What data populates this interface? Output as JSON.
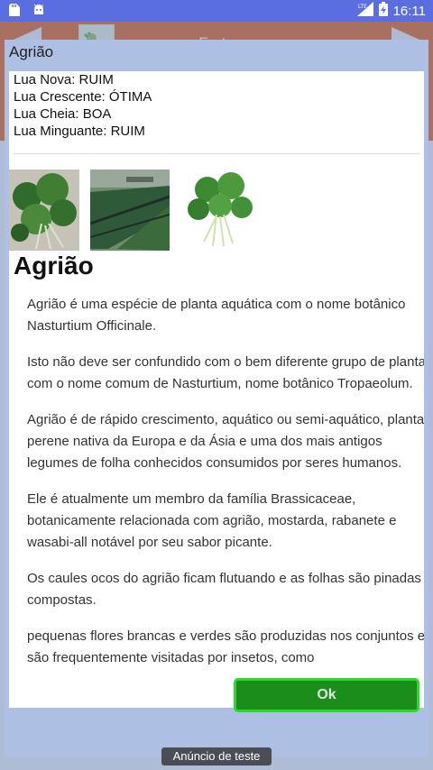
{
  "status_bar": {
    "time": "16:11",
    "network": "LTE",
    "battery_level": "charging"
  },
  "background_app": {
    "title": "Fruto"
  },
  "dialog": {
    "title": "Agrião",
    "moon_phases": [
      "Lua Nova: RUIM",
      "Lua Crescente: ÓTIMA",
      "Lua Cheia: BOA",
      "Lua Minguante: RUIM"
    ],
    "heading": "Agrião",
    "paragraphs": [
      "Agrião é uma espécie de planta aquática com o nome botânico Nasturtium Officinale.",
      "Isto não deve ser confundido com o bem diferente grupo de plantas com o nome comum de Nasturtium, nome botânico Tropaeolum.",
      "Agrião é de rápido crescimento, aquático ou semi-aquático, planta perene nativa da Europa e da Ásia e uma dos mais antigos legumes de folha conhecidos consumidos por seres humanos.",
      "Ele é atualmente um membro da família Brassicaceae, botanicamente relacionada com agrião, mostarda, rabanete e wasabi-all notável por seu sabor picante.",
      "Os caules ocos do agrião ficam flutuando e as folhas são pinadas e compostas.",
      "pequenas flores brancas e verdes são produzidas nos conjuntos e são frequentemente visitadas por insetos, como"
    ],
    "ok_label": "Ok"
  },
  "ad_label": "Anúncio de teste",
  "colors": {
    "accent_orange": "#e7732c",
    "status_bar": "#5b6ee1",
    "ok_green": "#1a8d1a",
    "ok_border": "#2cd82c"
  }
}
